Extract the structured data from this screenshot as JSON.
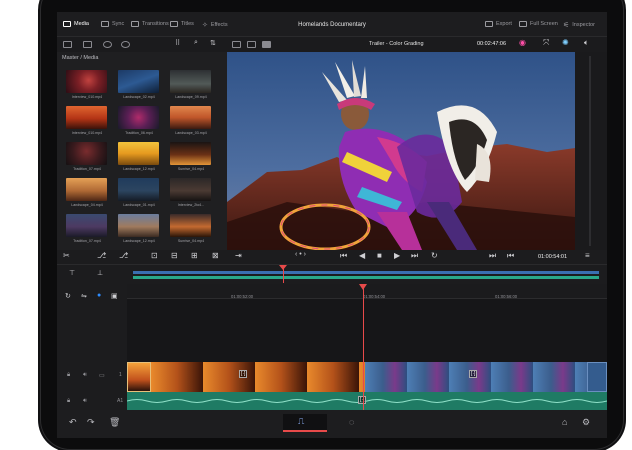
{
  "colors": {
    "accent": "#e23b3b",
    "audio_wave": "#2aa889",
    "active_tab": "#ffffff",
    "playhead": "#e84a4a"
  },
  "top_tabs": [
    {
      "label": "Media",
      "icon": "media-icon",
      "active": true
    },
    {
      "label": "Sync",
      "icon": "sync-icon",
      "active": false
    },
    {
      "label": "Transitions",
      "icon": "transitions-icon",
      "active": false
    },
    {
      "label": "Titles",
      "icon": "titles-icon",
      "active": false
    },
    {
      "label": "Effects",
      "icon": "effects-icon",
      "active": false
    }
  ],
  "project_title": "Homelands Documentary",
  "right_actions": [
    {
      "label": "Export",
      "icon": "export-icon"
    },
    {
      "label": "Full Screen",
      "icon": "fullscreen-icon"
    },
    {
      "label": "Inspector",
      "icon": "inspector-icon"
    }
  ],
  "viewer": {
    "title": "Trailer - Color Grading",
    "timecode": "00:02:47:06",
    "playhead_timecode": "01:00:54:01"
  },
  "library": {
    "breadcrumb": "Master / Media",
    "items": [
      {
        "label": "Interview_010.mp4"
      },
      {
        "label": "Landscape_02.mp4"
      },
      {
        "label": "Landscape_09.mp4"
      },
      {
        "label": "Interview_010.mp4"
      },
      {
        "label": "Tradition_06.mp4"
      },
      {
        "label": "Landscape_03.mp4"
      },
      {
        "label": "Tradition_07.mp4"
      },
      {
        "label": "Landscape_12.mp4"
      },
      {
        "label": "Sunrise_04.mp4"
      },
      {
        "label": "Landscape_04.mp4"
      },
      {
        "label": "Landscape_01.mp4"
      },
      {
        "label": "Interview_2to4..."
      },
      {
        "label": "Tradition_07.mp4"
      },
      {
        "label": "Landscape_12.mp4"
      },
      {
        "label": "Sunrise_04.mp4"
      }
    ]
  },
  "timeline": {
    "ticks": [
      "01:00:52:00",
      "01:00:54:00",
      "01:00:56:00"
    ],
    "video_track_num": "1",
    "audio_track_label": "A1"
  }
}
